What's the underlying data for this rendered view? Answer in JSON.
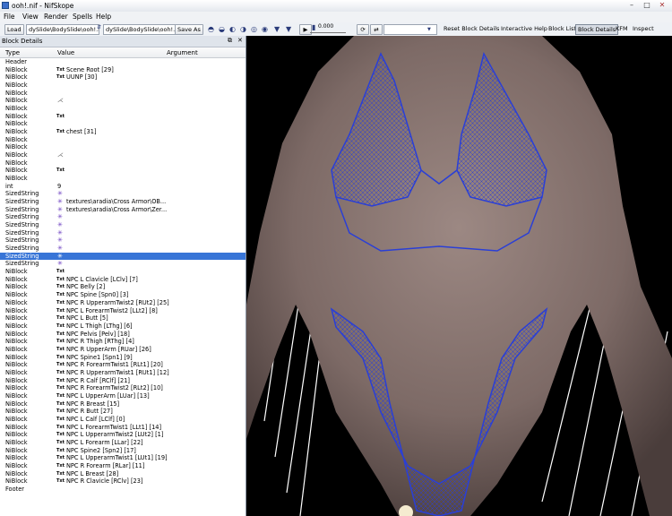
{
  "window": {
    "title": "ooh!.nif - NifSkope",
    "icon": "nifskope-app-icon"
  },
  "menu": [
    "File",
    "View",
    "Render",
    "Spells",
    "Help"
  ],
  "toolbar": {
    "load_label": "Load",
    "load_path": "dySlide\\BodySlide\\ooh!.nif",
    "save_path": "dySlide\\BodySlide\\ooh!.nif",
    "save_as_label": "Save As",
    "time_value": "0.000",
    "reset_label": "Reset Block Details",
    "interactive_help_label": "Interactive Help",
    "block_list_label": "Block List",
    "block_details_label": "Block Details",
    "kfm_label": "KFM",
    "inspect_label": "Inspect"
  },
  "dock": {
    "title": "Block Details",
    "columns": {
      "type": "Type",
      "value": "Value",
      "argument": "Argument"
    }
  },
  "rows": [
    {
      "type": "Header",
      "icon": "",
      "value": ""
    },
    {
      "type": "NiBlock",
      "icon": "txt",
      "value": "Scene Root [29]"
    },
    {
      "type": "NiBlock",
      "icon": "txt",
      "value": "UUNP [30]"
    },
    {
      "type": "NiBlock",
      "icon": "",
      "value": ""
    },
    {
      "type": "NiBlock",
      "icon": "",
      "value": ""
    },
    {
      "type": "NiBlock",
      "icon": "axes",
      "value": ""
    },
    {
      "type": "NiBlock",
      "icon": "",
      "value": ""
    },
    {
      "type": "NiBlock",
      "icon": "txt",
      "value": ""
    },
    {
      "type": "NiBlock",
      "icon": "",
      "value": ""
    },
    {
      "type": "NiBlock",
      "icon": "txt",
      "value": "chest [31]"
    },
    {
      "type": "NiBlock",
      "icon": "",
      "value": ""
    },
    {
      "type": "NiBlock",
      "icon": "",
      "value": ""
    },
    {
      "type": "NiBlock",
      "icon": "axes",
      "value": ""
    },
    {
      "type": "NiBlock",
      "icon": "",
      "value": ""
    },
    {
      "type": "NiBlock",
      "icon": "txt",
      "value": ""
    },
    {
      "type": "NiBlock",
      "icon": "",
      "value": ""
    },
    {
      "type": "int",
      "icon": "",
      "value": "9"
    },
    {
      "type": "SizedString",
      "icon": "star",
      "value": ""
    },
    {
      "type": "SizedString",
      "icon": "star",
      "value": "textures\\aradia\\Cross Armor\\OB..."
    },
    {
      "type": "SizedString",
      "icon": "star",
      "value": "textures\\aradia\\Cross Armor\\Zer..."
    },
    {
      "type": "SizedString",
      "icon": "star",
      "value": ""
    },
    {
      "type": "SizedString",
      "icon": "star",
      "value": ""
    },
    {
      "type": "SizedString",
      "icon": "star",
      "value": ""
    },
    {
      "type": "SizedString",
      "icon": "star",
      "value": ""
    },
    {
      "type": "SizedString",
      "icon": "star",
      "value": ""
    },
    {
      "type": "SizedString",
      "icon": "star",
      "value": "",
      "selected": true
    },
    {
      "type": "SizedString",
      "icon": "star",
      "value": ""
    },
    {
      "type": "NiBlock",
      "icon": "txt",
      "value": ""
    },
    {
      "type": "NiBlock",
      "icon": "txt",
      "value": "NPC L Clavicle [LClv] [7]"
    },
    {
      "type": "NiBlock",
      "icon": "txt",
      "value": "NPC Belly [2]"
    },
    {
      "type": "NiBlock",
      "icon": "txt",
      "value": "NPC Spine [Spn0] [3]"
    },
    {
      "type": "NiBlock",
      "icon": "txt",
      "value": "NPC R UpperarmTwist2 [RUt2] [25]"
    },
    {
      "type": "NiBlock",
      "icon": "txt",
      "value": "NPC L ForearmTwist2 [LLt2] [8]"
    },
    {
      "type": "NiBlock",
      "icon": "txt",
      "value": "NPC L Butt [5]"
    },
    {
      "type": "NiBlock",
      "icon": "txt",
      "value": "NPC L Thigh [LThg] [6]"
    },
    {
      "type": "NiBlock",
      "icon": "txt",
      "value": "NPC Pelvis [Pelv] [18]"
    },
    {
      "type": "NiBlock",
      "icon": "txt",
      "value": "NPC R Thigh [RThg] [4]"
    },
    {
      "type": "NiBlock",
      "icon": "txt",
      "value": "NPC R UpperArm [RUar] [26]"
    },
    {
      "type": "NiBlock",
      "icon": "txt",
      "value": "NPC Spine1 [Spn1] [9]"
    },
    {
      "type": "NiBlock",
      "icon": "txt",
      "value": "NPC R ForearmTwist1 [RLt1] [20]"
    },
    {
      "type": "NiBlock",
      "icon": "txt",
      "value": "NPC R UpperarmTwist1 [RUt1] [12]"
    },
    {
      "type": "NiBlock",
      "icon": "txt",
      "value": "NPC R Calf [RClf] [21]"
    },
    {
      "type": "NiBlock",
      "icon": "txt",
      "value": "NPC R ForearmTwist2 [RLt2] [10]"
    },
    {
      "type": "NiBlock",
      "icon": "txt",
      "value": "NPC L UpperArm [LUar] [13]"
    },
    {
      "type": "NiBlock",
      "icon": "txt",
      "value": "NPC R Breast [15]"
    },
    {
      "type": "NiBlock",
      "icon": "txt",
      "value": "NPC R Butt [27]"
    },
    {
      "type": "NiBlock",
      "icon": "txt",
      "value": "NPC L Calf [LClf] [0]"
    },
    {
      "type": "NiBlock",
      "icon": "txt",
      "value": "NPC L ForearmTwist1 [LLt1] [14]"
    },
    {
      "type": "NiBlock",
      "icon": "txt",
      "value": "NPC L UpperarmTwist2 [LUt2] [1]"
    },
    {
      "type": "NiBlock",
      "icon": "txt",
      "value": "NPC L Forearm [LLar] [22]"
    },
    {
      "type": "NiBlock",
      "icon": "txt",
      "value": "NPC Spine2 [Spn2] [17]"
    },
    {
      "type": "NiBlock",
      "icon": "txt",
      "value": "NPC L UpperarmTwist1 [LUt1] [19]"
    },
    {
      "type": "NiBlock",
      "icon": "txt",
      "value": "NPC R Forearm [RLar] [11]"
    },
    {
      "type": "NiBlock",
      "icon": "txt",
      "value": "NPC L Breast [28]"
    },
    {
      "type": "NiBlock",
      "icon": "txt",
      "value": "NPC R Clavicle [RClv] [23]"
    },
    {
      "type": "Footer",
      "icon": "",
      "value": ""
    }
  ],
  "icon_glyphs": {
    "txt": "Txt",
    "star": "✳",
    "axes": "⋌"
  },
  "colors": {
    "selection": "#3875d7",
    "mesh_wire": "#2a3fd6",
    "skin": "#8a7570",
    "background": "#000000"
  }
}
